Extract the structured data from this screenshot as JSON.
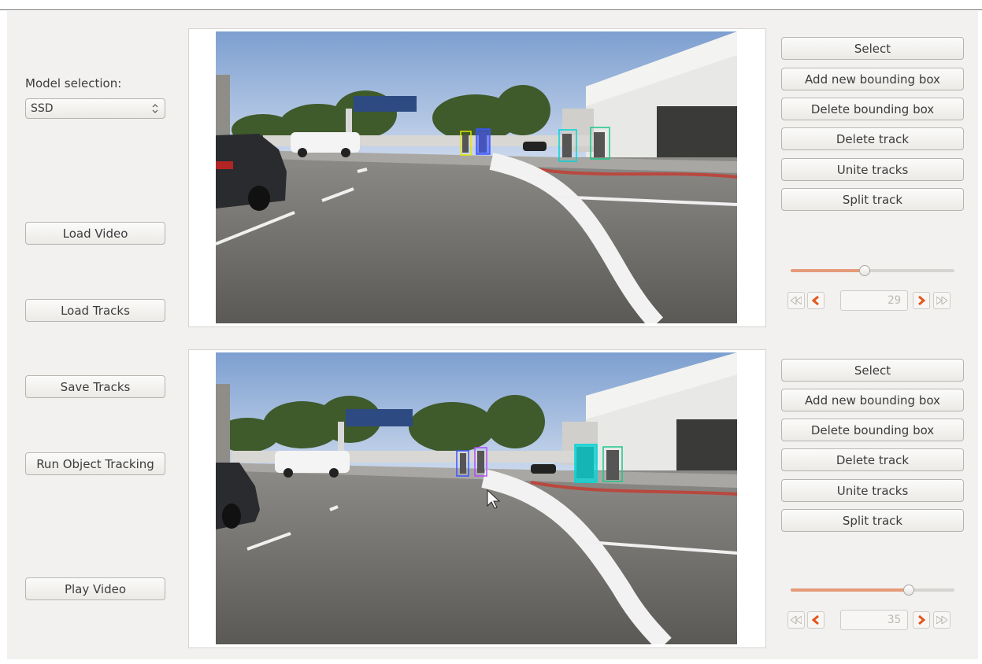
{
  "left_panel": {
    "model_label": "Model selection:",
    "model_value": "SSD",
    "load_video": "Load Video",
    "load_tracks": "Load Tracks",
    "save_tracks": "Save Tracks",
    "run_tracking": "Run Object Tracking",
    "play_video": "Play Video"
  },
  "top_tools": {
    "select": "Select",
    "add_box": "Add new bounding box",
    "delete_box": "Delete bounding box",
    "delete_track": "Delete track",
    "unite_tracks": "Unite tracks",
    "split_track": "Split track",
    "frame": "29",
    "slider_value": 0.45
  },
  "bottom_tools": {
    "select": "Select",
    "add_box": "Add new bounding box",
    "delete_box": "Delete bounding box",
    "delete_track": "Delete track",
    "unite_tracks": "Unite tracks",
    "split_track": "Split track",
    "frame": "35",
    "slider_value": 0.72
  },
  "colors": {
    "accent": "#e59b79",
    "nav_orange": "#e2571c",
    "box_yellow": "#e6e600",
    "box_blue": "#3b55ff",
    "box_cyan": "#00d6d6",
    "box_green": "#19c98a",
    "box_purple": "#b04dff"
  },
  "icons": [
    "combo-arrows-icon",
    "first-frame-icon",
    "prev-frame-icon",
    "next-frame-icon",
    "last-frame-icon",
    "mouse-cursor-icon"
  ]
}
